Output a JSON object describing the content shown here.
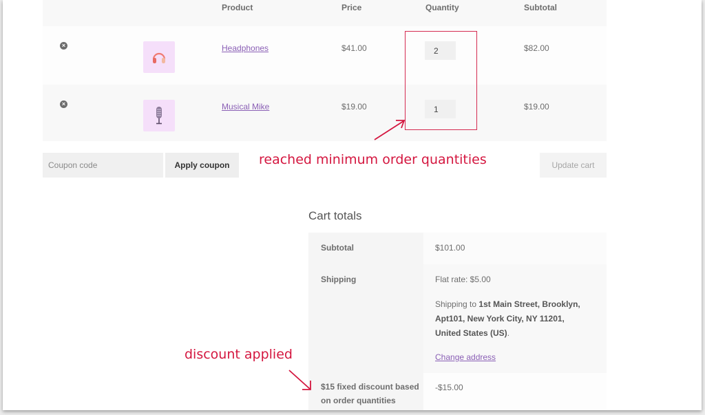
{
  "cart": {
    "columns": {
      "remove": "",
      "thumbnail": "",
      "product": "Product",
      "price": "Price",
      "quantity": "Quantity",
      "subtotal": "Subtotal"
    },
    "items": [
      {
        "remove_icon": "×",
        "thumbnail_icon": "headphones-icon",
        "name": "Headphones",
        "price": "$41.00",
        "quantity": "2",
        "subtotal": "$82.00"
      },
      {
        "remove_icon": "×",
        "thumbnail_icon": "microphone-icon",
        "name": "Musical Mike",
        "price": "$19.00",
        "quantity": "1",
        "subtotal": "$19.00"
      }
    ],
    "coupon": {
      "placeholder": "Coupon code",
      "value": "",
      "apply_label": "Apply coupon"
    },
    "update_label": "Update cart"
  },
  "annotations": {
    "quantity_note": "reached minimum order quantities",
    "discount_note": "discount applied",
    "color": "#d4163f"
  },
  "totals": {
    "title": "Cart totals",
    "subtotal_label": "Subtotal",
    "subtotal_value": "$101.00",
    "shipping_label": "Shipping",
    "shipping_rate": "Flat rate: $5.00",
    "shipping_to_prefix": "Shipping to",
    "shipping_address": "1st Main Street, Brooklyn, Apt101, New York City, NY 11201, United States (US)",
    "shipping_to_suffix": ".",
    "change_address": "Change address",
    "discount_label": "$15 fixed discount based on order quantities",
    "discount_value": "-$15.00"
  },
  "colors": {
    "link": "#8a5fb5",
    "thumbnail_bg": "#f5dffa",
    "annotation": "#d4163f"
  }
}
